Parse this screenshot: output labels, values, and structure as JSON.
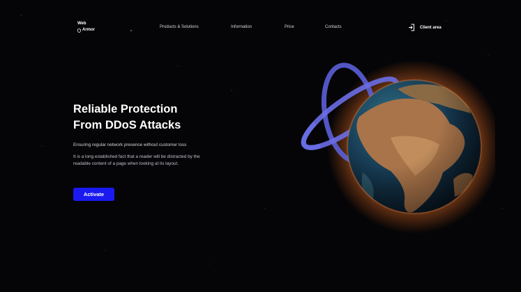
{
  "brand": {
    "line1": "Web",
    "line2": "Armor",
    "icon": "shield-icon"
  },
  "nav": {
    "items": [
      {
        "label": "Products & Solutions"
      },
      {
        "label": "Information"
      },
      {
        "label": "Price"
      },
      {
        "label": "Contacts"
      }
    ]
  },
  "client_area": {
    "label": "Client area",
    "icon": "login-icon"
  },
  "hero": {
    "title_line1": "Reliable Protection",
    "title_line2": "From DDoS Attacks",
    "subtitle": "Ensuring regular network presence without customer loss",
    "description": "It is a long established fact that a reader will be distracted by the readable content of a page when looking at its layout.",
    "cta_label": "Activate"
  },
  "colors": {
    "background": "#050507",
    "accent": "#1a1af0",
    "ring": "#5b5fd8",
    "text": "#ffffff"
  },
  "illustration": {
    "name": "earth-globe-with-orbit-rings"
  }
}
